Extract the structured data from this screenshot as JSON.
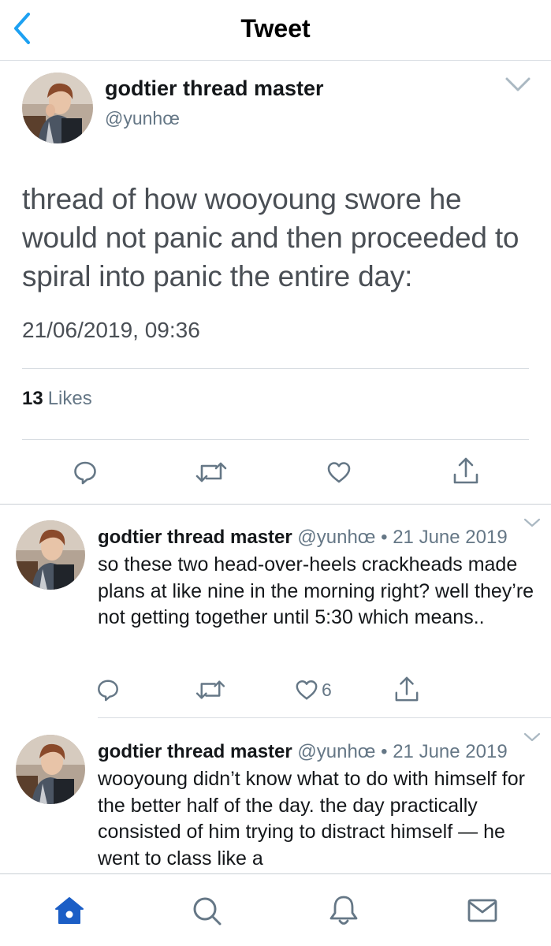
{
  "header": {
    "title": "Tweet"
  },
  "colors": {
    "accent": "#1da1f2",
    "gray": "#657786",
    "tab_active": "#1b5ec6"
  },
  "main_tweet": {
    "name": "godtier thread master",
    "handle": "@yunhœ",
    "text": "thread of how wooyoung swore he would not panic and then proceeded to spiral into panic the entire day:",
    "timestamp": "21/06/2019, 09:36",
    "likes_count": "13",
    "likes_label": "Likes"
  },
  "replies": [
    {
      "name": "godtier thread master",
      "meta": " @yunhœ • 21 June 2019",
      "text": "so these two head-over-heels crackheads made plans at like nine in the morning right? well they’re not getting together until 5:30 which means..",
      "like_count": "6"
    },
    {
      "name": "godtier thread master",
      "meta": " @yunhœ • 21 June 2019",
      "text": "wooyoung didn’t know what to do with himself for the better half of the day. the day practically consisted of him trying to distract himself — he went to class like a"
    }
  ],
  "tabbar": {
    "items": [
      {
        "icon": "home-icon",
        "active": true
      },
      {
        "icon": "search-icon",
        "active": false
      },
      {
        "icon": "bell-icon",
        "active": false
      },
      {
        "icon": "mail-icon",
        "active": false
      }
    ]
  }
}
